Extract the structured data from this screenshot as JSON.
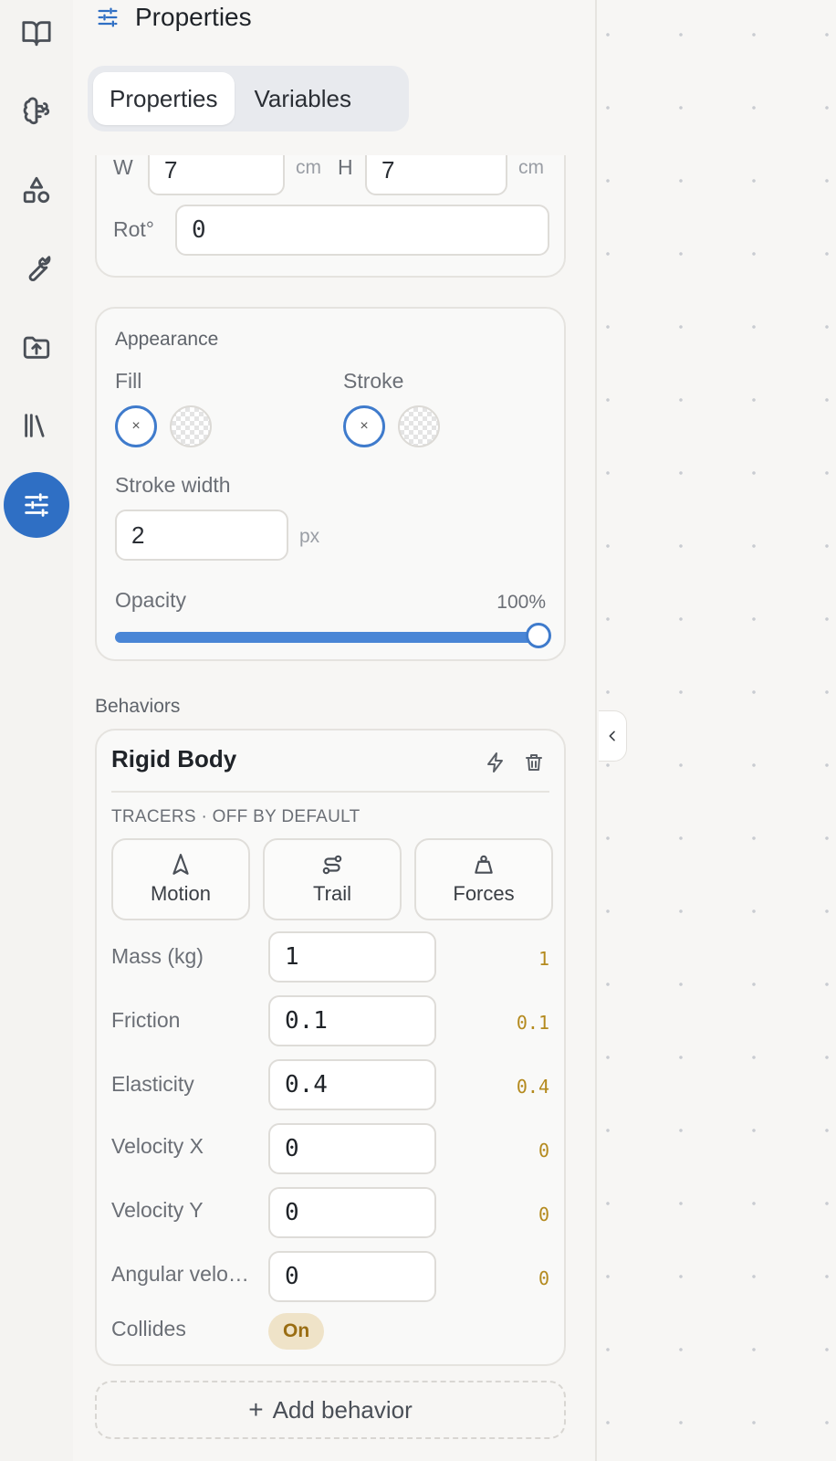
{
  "header": {
    "title": "Properties",
    "icon": "sliders-icon"
  },
  "tabs": [
    {
      "label": "Properties",
      "active": true
    },
    {
      "label": "Variables",
      "active": false
    }
  ],
  "rail": {
    "items": [
      {
        "icon": "book-icon"
      },
      {
        "icon": "brain-icon"
      },
      {
        "icon": "shapes-icon"
      },
      {
        "icon": "wrench-icon"
      },
      {
        "icon": "folder-upload-icon"
      },
      {
        "icon": "library-icon"
      },
      {
        "icon": "sliders-icon",
        "active": true
      }
    ],
    "active_color": "#2f6fc4"
  },
  "transform": {
    "w_label": "W",
    "w_value": "7",
    "w_unit": "cm",
    "h_label": "H",
    "h_value": "7",
    "h_unit": "cm",
    "rot_label": "Rot°",
    "rot_value": "0"
  },
  "appearance": {
    "title": "Appearance",
    "fill_label": "Fill",
    "stroke_label": "Stroke",
    "none_symbol": "×",
    "stroke_width_label": "Stroke width",
    "stroke_width_value": "2",
    "stroke_width_unit": "px",
    "opacity_label": "Opacity",
    "opacity_display": "100%",
    "opacity_fraction": 1.0
  },
  "behaviors": {
    "section_label": "Behaviors",
    "rigid_body": {
      "title": "Rigid Body",
      "tracers_label": "TRACERS · OFF BY DEFAULT",
      "tracers": [
        {
          "label": "Motion",
          "icon": "navigation-icon"
        },
        {
          "label": "Trail",
          "icon": "route-icon"
        },
        {
          "label": "Forces",
          "icon": "weight-icon"
        }
      ],
      "props": [
        {
          "label": "Mass (kg)",
          "value": "1",
          "display": "1"
        },
        {
          "label": "Friction",
          "value": "0.1",
          "display": "0.1"
        },
        {
          "label": "Elasticity",
          "value": "0.4",
          "display": "0.4"
        },
        {
          "label": "Velocity X",
          "value": "0",
          "display": "0"
        },
        {
          "label": "Velocity Y",
          "value": "0",
          "display": "0"
        },
        {
          "label": "Angular velo…",
          "value": "0",
          "display": "0"
        }
      ],
      "collides_label": "Collides",
      "collides_value": "On"
    },
    "add_label": "Add behavior"
  },
  "colors": {
    "accent": "#2f6fc4",
    "value_gold": "#b48a1e",
    "pill_bg": "#efe3c8"
  }
}
